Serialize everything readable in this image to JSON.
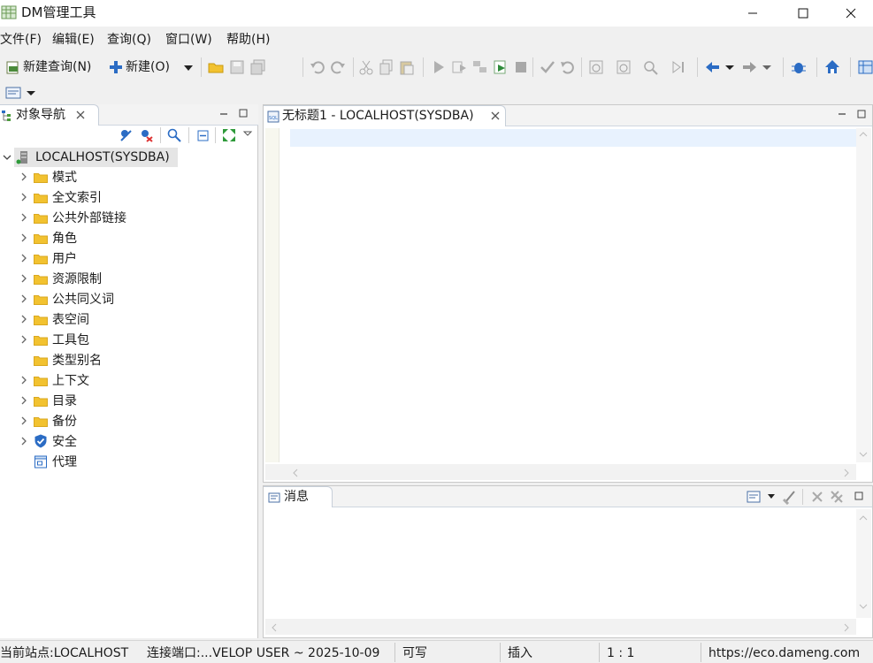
{
  "app": {
    "title": "DM管理工具"
  },
  "menu": [
    "文件(F)",
    "编辑(E)",
    "查询(Q)",
    "窗口(W)",
    "帮助(H)"
  ],
  "toolbar": {
    "new_query_label": "新建查询(N)",
    "new_label": "新建(O)"
  },
  "navigator": {
    "tab_label": "对象导航",
    "root": "LOCALHOST(SYSDBA)",
    "items": [
      {
        "label": "模式",
        "expandable": true,
        "icon": "folder-icon"
      },
      {
        "label": "全文索引",
        "expandable": true,
        "icon": "folder-icon"
      },
      {
        "label": "公共外部链接",
        "expandable": true,
        "icon": "folder-icon"
      },
      {
        "label": "角色",
        "expandable": true,
        "icon": "folder-icon"
      },
      {
        "label": "用户",
        "expandable": true,
        "icon": "folder-icon"
      },
      {
        "label": "资源限制",
        "expandable": true,
        "icon": "folder-icon"
      },
      {
        "label": "公共同义词",
        "expandable": true,
        "icon": "folder-icon"
      },
      {
        "label": "表空间",
        "expandable": true,
        "icon": "folder-icon"
      },
      {
        "label": "工具包",
        "expandable": true,
        "icon": "folder-icon"
      },
      {
        "label": "类型别名",
        "expandable": false,
        "icon": "folder-icon"
      },
      {
        "label": "上下文",
        "expandable": true,
        "icon": "folder-icon"
      },
      {
        "label": "目录",
        "expandable": true,
        "icon": "folder-icon"
      },
      {
        "label": "备份",
        "expandable": true,
        "icon": "folder-icon"
      },
      {
        "label": "安全",
        "expandable": true,
        "icon": "shield-icon"
      },
      {
        "label": "代理",
        "expandable": false,
        "icon": "proxy-icon"
      }
    ]
  },
  "editor": {
    "tab_label": "无标题1 - LOCALHOST(SYSDBA)"
  },
  "messages": {
    "tab_label": "消息"
  },
  "status": {
    "site": "当前站点:LOCALHOST",
    "port": "连接端口:...VELOP USER ~ 2025-10-09",
    "mode": "可写",
    "insert": "插入",
    "position": "1 : 1",
    "url": "https://eco.dameng.com"
  },
  "colors": {
    "folder": "#f2c230",
    "accent": "#2b6cc4",
    "highlight": "#e8f2fe"
  }
}
